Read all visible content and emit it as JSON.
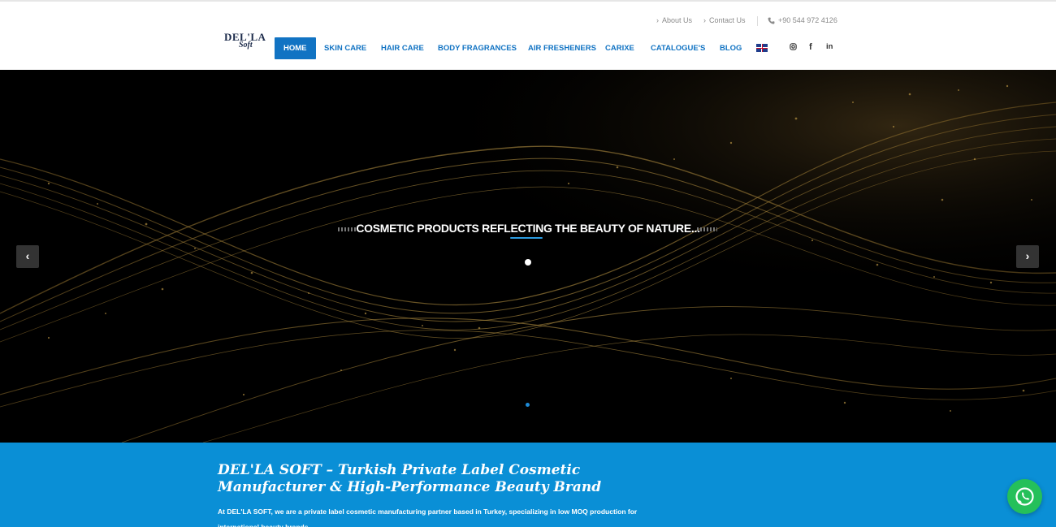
{
  "brand": {
    "logo_main": "DEL'LA",
    "logo_sub": "Soft"
  },
  "topbar": {
    "about": "About Us",
    "contact": "Contact Us",
    "phone": "+90 544 972 4126"
  },
  "nav": {
    "items": [
      "HOME",
      "SKIN CARE",
      "HAIR CARE",
      "BODY FRAGRANCES",
      "AIR FRESHENERS",
      "CARIXE",
      "CATALOGUE'S",
      "BLOG"
    ],
    "active_index": 0,
    "language_flag": "uk-flag-icon",
    "social": {
      "instagram": "instagram-icon",
      "facebook": "facebook-icon",
      "linkedin": "linkedin-icon"
    }
  },
  "hero": {
    "title": "COSMETIC PRODUCTS REFLECTING THE BEAUTY OF NATURE...",
    "prev_icon": "chevron-left-icon",
    "next_icon": "chevron-right-icon"
  },
  "intro": {
    "heading": "DEL'LA SOFT – Turkish Private Label Cosmetic Manufacturer & High-Performance Beauty Brand",
    "text_prefix": "At ",
    "text_brand": "DEL'LA SOFT",
    "text_rest": ", we are a private label cosmetic manufacturing partner based in Turkey, specializing in low MOQ production for international beauty brands."
  },
  "whatsapp": {
    "icon": "whatsapp-icon"
  },
  "colors": {
    "brand_blue": "#1173c3",
    "intro_band": "#0a8fd6",
    "hero_bg": "#000000",
    "gold": "#c9a24a",
    "whatsapp_green": "#25c05a"
  }
}
